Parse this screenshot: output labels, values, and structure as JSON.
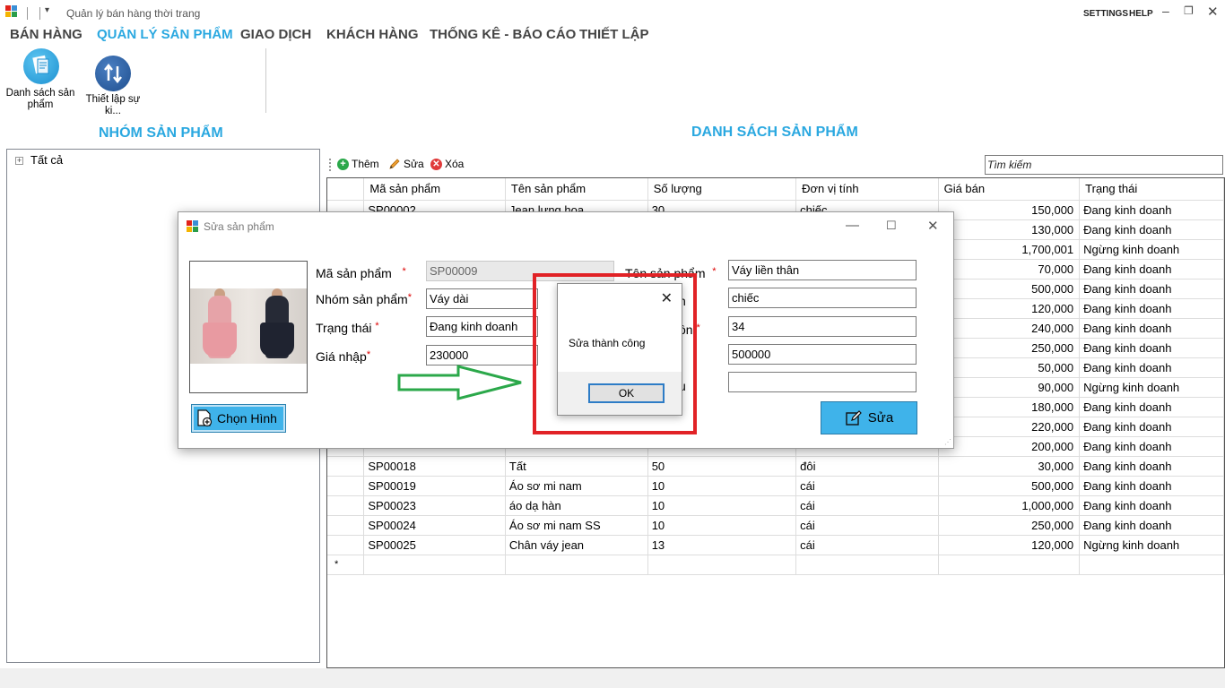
{
  "window": {
    "title": "Quản lý bán hàng thời trang",
    "settings": "SETTINGS",
    "help": "HELP"
  },
  "ribbon": {
    "tabs": [
      "BÁN HÀNG",
      "QUẢN LÝ SẢN PHẨM",
      "GIAO DỊCH",
      "KHÁCH HÀNG",
      "THỐNG KÊ - BÁO CÁO",
      "THIẾT LẬP"
    ],
    "active_tab": "QUẢN LÝ SẢN PHẨM",
    "buttons": [
      {
        "label_line1": "Danh sách sản",
        "label_line2": "phẩm",
        "icon": "product-list-icon"
      },
      {
        "label": "Thiết lập sự ki...",
        "icon": "event-setup-icon"
      }
    ]
  },
  "left_panel": {
    "title": "NHÓM SẢN PHẨM",
    "tree": [
      {
        "label": "Tất cả",
        "expander": "⊞"
      }
    ]
  },
  "main": {
    "title": "DANH SÁCH SẢN PHẨM",
    "toolbar": {
      "add": "Thêm",
      "edit": "Sửa",
      "delete": "Xóa"
    },
    "search": {
      "value": "Tìm kiếm"
    },
    "columns": [
      "Mã sản phẩm",
      "Tên sản phẩm",
      "Số lượng",
      "Đơn vị tính",
      "Giá bán",
      "Trạng thái"
    ],
    "rows": [
      [
        "SP00002",
        "Jean lưng hoa",
        "30",
        "chiếc",
        "150,000",
        "Đang kinh doanh"
      ],
      [
        "",
        "",
        "",
        "",
        "130,000",
        "Đang kinh doanh"
      ],
      [
        "",
        "",
        "",
        "",
        "1,700,001",
        "Ngừng kinh doanh"
      ],
      [
        "",
        "",
        "",
        "",
        "70,000",
        "Đang kinh doanh"
      ],
      [
        "",
        "",
        "",
        "",
        "500,000",
        "Đang kinh doanh"
      ],
      [
        "",
        "",
        "",
        "",
        "120,000",
        "Đang kinh doanh"
      ],
      [
        "",
        "",
        "",
        "",
        "240,000",
        "Đang kinh doanh"
      ],
      [
        "",
        "",
        "",
        "",
        "250,000",
        "Đang kinh doanh"
      ],
      [
        "",
        "",
        "",
        "",
        "50,000",
        "Đang kinh doanh"
      ],
      [
        "",
        "",
        "",
        "",
        "90,000",
        "Ngừng kinh doanh"
      ],
      [
        "",
        "",
        "",
        "",
        "180,000",
        "Đang kinh doanh"
      ],
      [
        "",
        "",
        "",
        "",
        "220,000",
        "Đang kinh doanh"
      ],
      [
        "",
        "",
        "",
        "",
        "200,000",
        "Đang kinh doanh"
      ],
      [
        "SP00018",
        "Tất",
        "50",
        "đôi",
        "30,000",
        "Đang kinh doanh"
      ],
      [
        "SP00019",
        "Áo sơ mi nam",
        "10",
        "cái",
        "500,000",
        "Đang kinh doanh"
      ],
      [
        "SP00023",
        "áo dạ hàn",
        "10",
        "cái",
        "1,000,000",
        "Đang kinh doanh"
      ],
      [
        "SP00024",
        "Áo sơ mi nam SS",
        "10",
        "cái",
        "250,000",
        "Đang kinh doanh"
      ],
      [
        "SP00025",
        "Chân váy jean",
        "13",
        "cái",
        "120,000",
        "Ngừng kinh doanh"
      ]
    ],
    "new_row_marker": "*"
  },
  "edit_dialog": {
    "title": "Sửa sản phẩm",
    "choose_image": "Chọn Hình",
    "labels": {
      "code": "Mã sản phẩm",
      "group": "Nhóm sản phẩm",
      "status": "Trạng thái",
      "import_price": "Giá nhập",
      "name": "Tên sản phẩm"
    },
    "required_mark": "*",
    "values": {
      "code": "SP00009",
      "group": "Váy dài",
      "status": "Đang kinh doanh",
      "import_price": "230000",
      "name": "Váy liền thân",
      "unit": "chiếc",
      "quantity": "34",
      "sale_price": "500000",
      "extra": ""
    },
    "save_button": "Sửa"
  },
  "message_box": {
    "text": "Sửa thành công",
    "ok": "OK"
  },
  "colors": {
    "accent": "#2aa8e0",
    "button_blue": "#3fb3ea",
    "annotation_red": "#e12226",
    "annotation_green": "#2ba84a"
  }
}
